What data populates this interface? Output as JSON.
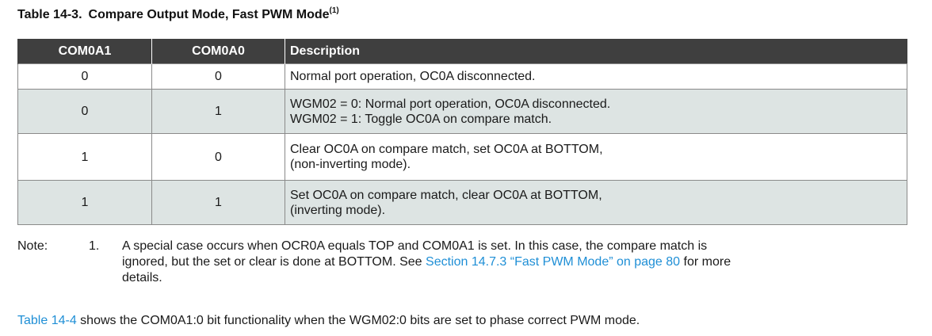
{
  "caption": {
    "number": "Table 14-3.",
    "title": "Compare Output Mode, Fast PWM Mode",
    "footnote_ref": "(1)"
  },
  "table": {
    "headers": [
      "COM0A1",
      "COM0A0",
      "Description"
    ],
    "rows": [
      {
        "c1": "0",
        "c2": "0",
        "desc": [
          "Normal port operation, OC0A disconnected."
        ]
      },
      {
        "c1": "0",
        "c2": "1",
        "desc": [
          "WGM02 = 0: Normal port operation, OC0A disconnected.",
          "WGM02 = 1: Toggle OC0A on compare match."
        ]
      },
      {
        "c1": "1",
        "c2": "0",
        "desc": [
          "Clear OC0A on compare match, set OC0A at BOTTOM,",
          "(non-inverting mode)."
        ]
      },
      {
        "c1": "1",
        "c2": "1",
        "desc": [
          "Set OC0A on compare match, clear OC0A at BOTTOM,",
          "(inverting mode)."
        ]
      }
    ]
  },
  "note": {
    "label": "Note:",
    "number": "1.",
    "line1": "A special case occurs when OCR0A equals TOP and COM0A1 is set. In this case, the compare match is",
    "line2_before": "ignored, but the set or clear is done at BOTTOM. See ",
    "link_text": "Section 14.7.3 “Fast PWM Mode” on page 80",
    "line2_after": " for more",
    "line3": "details."
  },
  "paragraph": {
    "link_text": "Table 14-4",
    "rest": " shows the COM0A1:0 bit functionality when the WGM02:0 bits are set to phase correct PWM mode."
  },
  "colors": {
    "header_bg": "#3f3f3f",
    "shaded_row": "#dde4e3",
    "link": "#1f8fd6"
  }
}
